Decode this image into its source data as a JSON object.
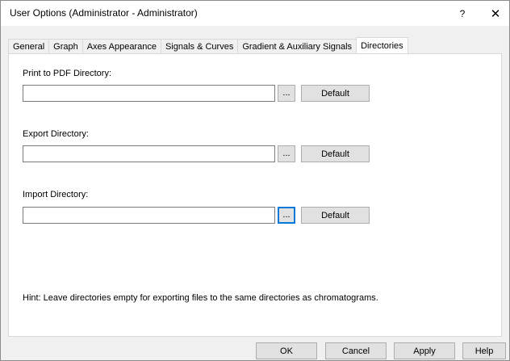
{
  "window": {
    "title": "User Options (Administrator - Administrator)",
    "help_label": "?",
    "close_label": "✕"
  },
  "tabs": [
    {
      "label": "General",
      "active": false
    },
    {
      "label": "Graph",
      "active": false
    },
    {
      "label": "Axes Appearance",
      "active": false
    },
    {
      "label": "Signals & Curves",
      "active": false
    },
    {
      "label": "Gradient & Auxiliary Signals",
      "active": false
    },
    {
      "label": "Directories",
      "active": true
    }
  ],
  "directories": {
    "pdf": {
      "label": "Print to PDF Directory:",
      "value": "",
      "browse_label": "...",
      "default_label": "Default"
    },
    "export": {
      "label": "Export Directory:",
      "value": "",
      "browse_label": "...",
      "default_label": "Default"
    },
    "import": {
      "label": "Import Directory:",
      "value": "",
      "browse_label": "...",
      "default_label": "Default"
    }
  },
  "hint": "Hint: Leave directories empty for exporting files to the same directories as chromatograms.",
  "buttons": {
    "ok": "OK",
    "cancel": "Cancel",
    "apply": "Apply",
    "help": "Help"
  },
  "colors": {
    "focus_accent": "#0078d7",
    "dialog_bg": "#f0f0f0",
    "panel_bg": "#ffffff"
  }
}
